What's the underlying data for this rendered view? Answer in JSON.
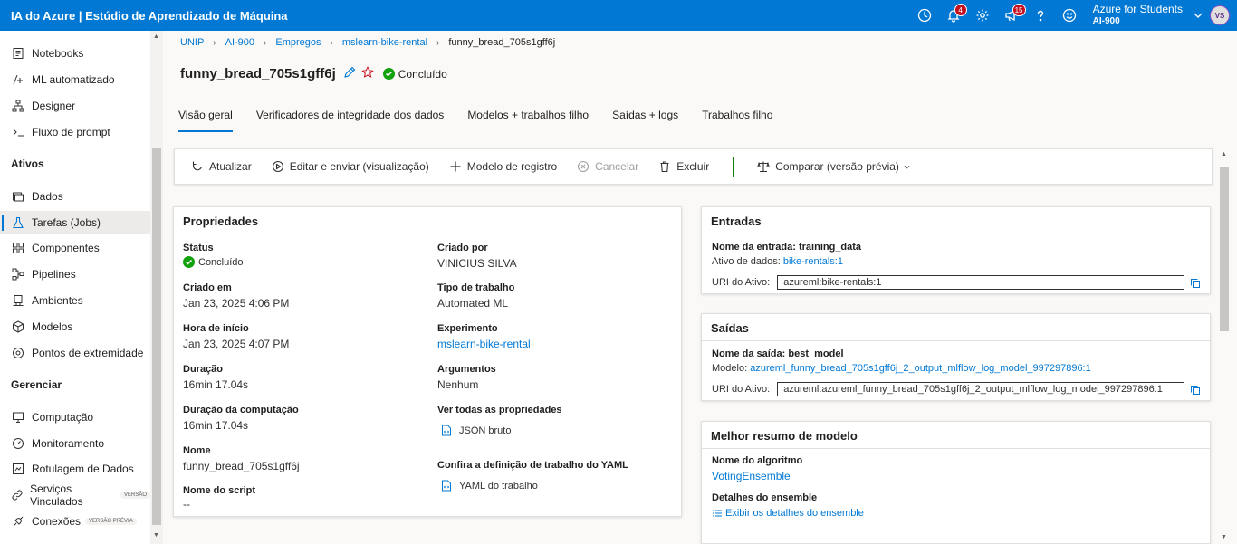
{
  "app_title": "IA do Azure | Estúdio de Aprendizado de Máquina",
  "topbar": {
    "notifications_badge": "4",
    "feedback_badge": "15",
    "account_name": "Azure for Students",
    "account_sub": "AI-900",
    "avatar_initials": "VS"
  },
  "sidebar": {
    "items_top": [
      {
        "label": "Notebooks",
        "icon": "notebook-icon"
      },
      {
        "label": "ML automatizado",
        "icon": "automl-icon"
      },
      {
        "label": "Designer",
        "icon": "designer-icon"
      },
      {
        "label": "Fluxo de prompt",
        "icon": "prompt-flow-icon"
      }
    ],
    "section_assets": "Ativos",
    "items_assets": [
      {
        "label": "Dados",
        "icon": "data-icon"
      },
      {
        "label": "Tarefas (Jobs)",
        "icon": "jobs-icon"
      },
      {
        "label": "Componentes",
        "icon": "components-icon"
      },
      {
        "label": "Pipelines",
        "icon": "pipelines-icon"
      },
      {
        "label": "Ambientes",
        "icon": "environments-icon"
      },
      {
        "label": "Modelos",
        "icon": "models-icon"
      },
      {
        "label": "Pontos de extremidade",
        "icon": "endpoints-icon"
      }
    ],
    "section_manage": "Gerenciar",
    "items_manage": [
      {
        "label": "Computação",
        "icon": "compute-icon"
      },
      {
        "label": "Monitoramento",
        "icon": "monitoring-icon"
      },
      {
        "label": "Rotulagem de Dados",
        "icon": "labeling-icon"
      },
      {
        "label": "Serviços Vinculados",
        "icon": "linked-services-icon",
        "tag": "VERSÃO"
      },
      {
        "label": "Conexões",
        "icon": "connections-icon",
        "tag": "VERSÃO PRÉVIA"
      }
    ]
  },
  "breadcrumb": [
    "UNIP",
    "AI-900",
    "Empregos",
    "mslearn-bike-rental",
    "funny_bread_705s1gff6j"
  ],
  "page_title": "funny_bread_705s1gff6j",
  "status_label": "Concluído",
  "tabs": [
    "Visão geral",
    "Verificadores de integridade dos dados",
    "Modelos + trabalhos filho",
    "Saídas + logs",
    "Trabalhos filho"
  ],
  "toolbar": {
    "refresh": "Atualizar",
    "edit_submit": "Editar e enviar (visualização)",
    "register_model": "Modelo de registro",
    "cancel": "Cancelar",
    "delete": "Excluir",
    "compare": "Comparar (versão prévia)"
  },
  "properties": {
    "title": "Propriedades",
    "status_label": "Status",
    "status_value": "Concluído",
    "created_on_label": "Criado em",
    "created_on_value": "Jan 23, 2025 4:06 PM",
    "start_time_label": "Hora de início",
    "start_time_value": "Jan 23, 2025 4:07 PM",
    "duration_label": "Duração",
    "duration_value": "16min 17.04s",
    "compute_duration_label": "Duração da computação",
    "compute_duration_value": "16min 17.04s",
    "name_label": "Nome",
    "name_value": "funny_bread_705s1gff6j",
    "script_name_label": "Nome do script",
    "script_name_value": "--",
    "created_by_label": "Criado por",
    "created_by_value": "VINICIUS SILVA",
    "job_type_label": "Tipo de trabalho",
    "job_type_value": "Automated ML",
    "experiment_label": "Experimento",
    "experiment_value": "mslearn-bike-rental",
    "arguments_label": "Argumentos",
    "arguments_value": "Nenhum",
    "all_props_label": "Ver todas as propriedades",
    "raw_json": "JSON bruto",
    "yaml_label": "Confira a definição de trabalho do YAML",
    "yaml_file": "YAML do trabalho"
  },
  "inputs": {
    "title": "Entradas",
    "input_name_label": "Nome da entrada:",
    "input_name_value": "training_data",
    "data_asset_label": "Ativo de dados:",
    "data_asset_value": "bike-rentals:1",
    "uri_label": "URI do Ativo:",
    "uri_value": "azureml:bike-rentals:1"
  },
  "outputs": {
    "title": "Saídas",
    "output_name_label": "Nome da saída:",
    "output_name_value": "best_model",
    "model_label": "Modelo:",
    "model_value": "azureml_funny_bread_705s1gff6j_2_output_mlflow_log_model_997297896:1",
    "uri_label": "URI do Ativo:",
    "uri_value": "azureml:azureml_funny_bread_705s1gff6j_2_output_mlflow_log_model_997297896:1"
  },
  "best_model": {
    "title": "Melhor resumo de modelo",
    "algorithm_label": "Nome do algoritmo",
    "algorithm_value": "VotingEnsemble",
    "ensemble_label": "Detalhes do ensemble",
    "ensemble_link": "Exibir os detalhes do ensemble"
  }
}
